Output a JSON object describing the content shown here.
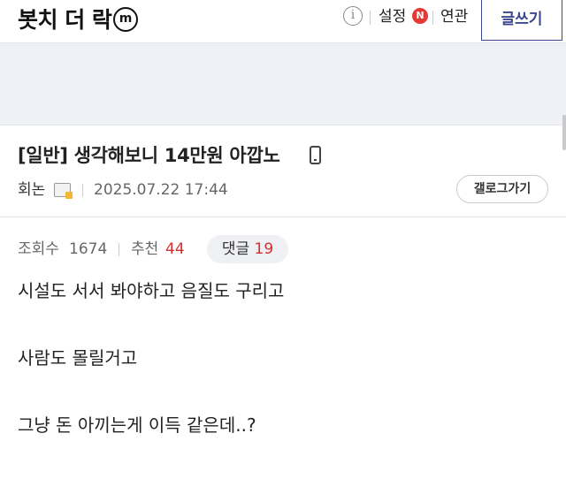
{
  "header": {
    "gallery_title": "봇치 더 락",
    "minor_badge": "m",
    "info_icon": "i",
    "settings_label": "설정",
    "new_badge": "N",
    "related_label": "연관",
    "write_label": "글쓰기"
  },
  "post": {
    "title": "[일반] 생각해보니 14만원 아깝노",
    "author": "회논",
    "date": "2025.07.22 17:44",
    "gallery_button": "갤로그가기",
    "stats": {
      "views_label": "조회수",
      "views": "1674",
      "recommend_label": "추천",
      "recommend": "44",
      "comments_label": "댓글",
      "comments": "19"
    },
    "body": [
      "시설도 서서 봐야하고 음질도 구리고",
      "사람도 몰릴거고",
      "그냥 돈 아끼는게 이득 같은데..?"
    ]
  },
  "icons": [
    "info-icon",
    "new-badge",
    "mobile-icon",
    "fixed-nick-icon"
  ],
  "colors": {
    "accent": "#3b4890",
    "count_red": "#d32f2f",
    "band_gray": "#eff1f6"
  }
}
